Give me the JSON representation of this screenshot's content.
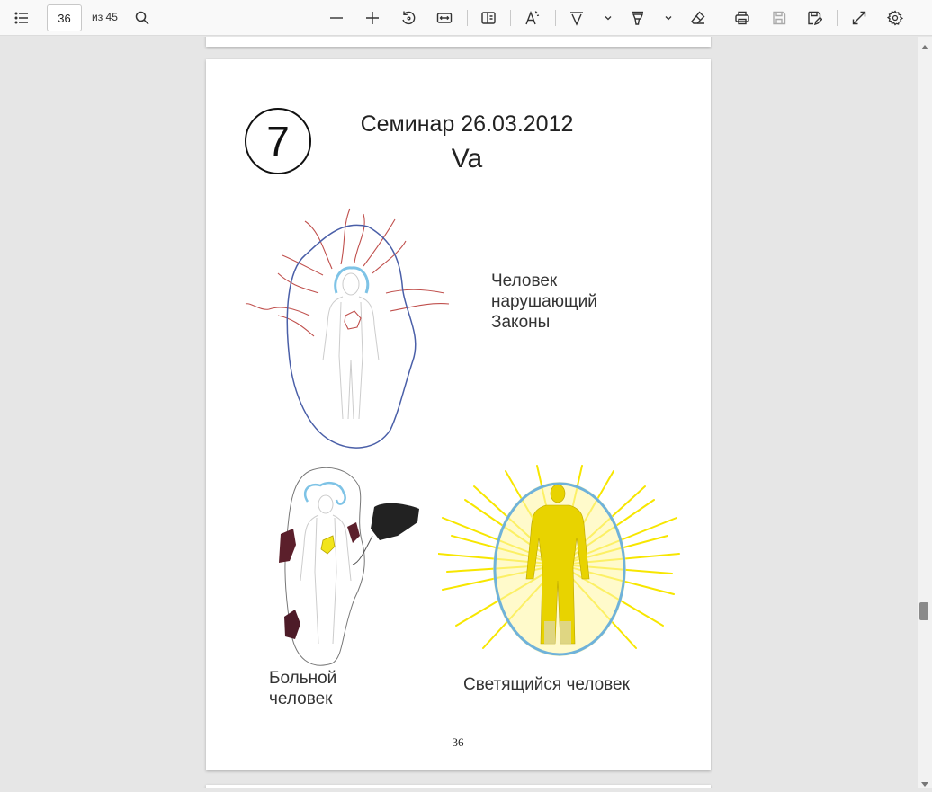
{
  "toolbar": {
    "page_number": "36",
    "page_total_text": "из 45"
  },
  "document": {
    "badge": "7",
    "title": "Семинар 26.03.2012",
    "subtitle": "Va",
    "label_violator": "Человек\nнарушающий\nЗаконы",
    "label_sick": "Больной\nчеловек",
    "label_glowing": "Светящийся человек",
    "page_footer": "36"
  },
  "colors": {
    "toolbar_bg": "#f9f9f9",
    "viewer_bg": "#e6e6e6",
    "aura_blue": "#4a5fa8",
    "red_lines": "#c0504d",
    "glow_yellow": "#f7e600",
    "head_blue": "#7ec3e6"
  }
}
